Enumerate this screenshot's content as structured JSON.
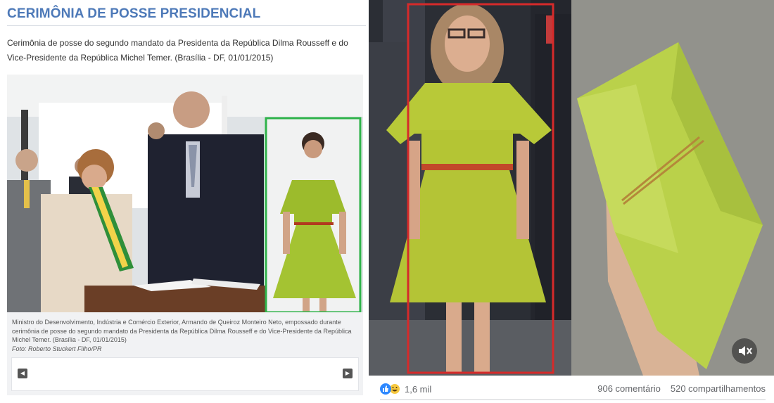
{
  "left": {
    "title": "CERIMÔNIA DE POSSE PRESIDENCIAL",
    "description": "Cerimônia de posse do segundo mandato da Presidenta da República Dilma Rousseff e do Vice-Presidente da República Michel Temer. (Brasília - DF, 01/01/2015)",
    "caption": "Ministro do Desenvolvimento, Indústria e Comércio Exterior, Armando de Queiroz Monteiro Neto, empossado durante cerimônia de posse do segundo mandato da Presidenta da República Dilma Rousseff e do Vice-Presidente da República Michel Temer. (Brasília - DF, 01/01/2015)",
    "credit": "Foto: Roberto Stuckert Filho/PR",
    "prev_icon": "arrow-left-icon",
    "next_icon": "arrow-right-icon",
    "highlight_color": "#2fb34a"
  },
  "right": {
    "reaction_icons": [
      "like-icon",
      "haha-icon"
    ],
    "reaction_count": "1,6 mil",
    "comments": "906 comentário",
    "shares": "520 compartilhamentos",
    "mute_icon": "muted-speaker-icon",
    "highlight_color": "#d62a2a"
  }
}
